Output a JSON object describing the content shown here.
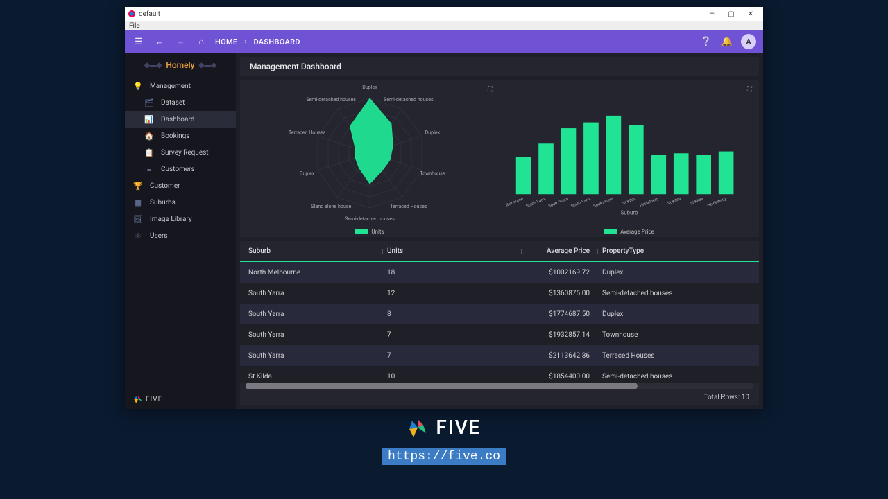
{
  "window": {
    "title": "default",
    "menu_file": "File",
    "min": "—",
    "max": "▢",
    "close": "✕"
  },
  "topbar": {
    "home": "HOME",
    "crumb": "DASHBOARD",
    "avatar": "A"
  },
  "logo": "Homely",
  "nav": [
    {
      "label": "Management",
      "icon": "💡",
      "child": false
    },
    {
      "label": "Dataset",
      "icon": "🗂",
      "child": true
    },
    {
      "label": "Dashboard",
      "icon": "📊",
      "child": true,
      "active": true
    },
    {
      "label": "Bookings",
      "icon": "🏠",
      "child": true
    },
    {
      "label": "Survey Request",
      "icon": "📋",
      "child": true
    },
    {
      "label": "Customers",
      "icon": "≡",
      "child": true
    },
    {
      "label": "Customer",
      "icon": "🏆",
      "child": false
    },
    {
      "label": "Suburbs",
      "icon": "▦",
      "child": false
    },
    {
      "label": "Image Library",
      "icon": "🖼",
      "child": false
    },
    {
      "label": "Users",
      "icon": "⚛",
      "child": false
    }
  ],
  "footer_brand": "FIVE",
  "page_title": "Management Dashboard",
  "table": {
    "headers": [
      "Suburb",
      "Units",
      "Average Price",
      "PropertyType"
    ],
    "rows": [
      {
        "suburb": "North Melbourne",
        "units": "18",
        "price": "$1002169.72",
        "type": "Duplex"
      },
      {
        "suburb": "South Yarra",
        "units": "12",
        "price": "$1360875.00",
        "type": "Semi-detached houses"
      },
      {
        "suburb": "South Yarra",
        "units": "8",
        "price": "$1774687.50",
        "type": "Duplex"
      },
      {
        "suburb": "South Yarra",
        "units": "7",
        "price": "$1932857.14",
        "type": "Townhouse"
      },
      {
        "suburb": "South Yarra",
        "units": "7",
        "price": "$2113642.86",
        "type": "Terraced Houses"
      },
      {
        "suburb": "St Kilda",
        "units": "10",
        "price": "$1854400.00",
        "type": "Semi-detached houses"
      }
    ],
    "total_rows_label": "Total Rows:",
    "total_rows": "10"
  },
  "legend": {
    "radar": "Units",
    "bars": "Average Price"
  },
  "axis": {
    "bars_x": "Suburb"
  },
  "chart_data": [
    {
      "type": "radar",
      "title": "",
      "categories": [
        "Duplex",
        "Semi-detached houses",
        "Duplex",
        "Townhouse",
        "Terraced Houses",
        "Semi-detached houses",
        "Stand alone house",
        "Duplex",
        "Terraced Houses",
        "Semi-detached houses"
      ],
      "values": [
        18,
        12,
        8,
        7,
        7,
        10,
        6,
        5,
        5,
        11
      ],
      "series_name": "Units",
      "max": 18
    },
    {
      "type": "bar",
      "title": "",
      "xlabel": "Suburb",
      "ylabel": "Average Price",
      "categories": [
        "North Melbourne",
        "South Yarra",
        "South Yarra",
        "South Yarra",
        "South Yarra",
        "St Kilda",
        "Heidelberg",
        "St Kilda",
        "St Kilda",
        "Heidelberg"
      ],
      "values": [
        1002169.72,
        1360875.0,
        1774687.5,
        1932857.14,
        2113642.86,
        1854400.0,
        1050000,
        1100000,
        1060000,
        1150000
      ],
      "ylim": [
        0,
        2200000
      ]
    }
  ],
  "brand": {
    "name": "FIVE",
    "url": "https://five.co"
  }
}
